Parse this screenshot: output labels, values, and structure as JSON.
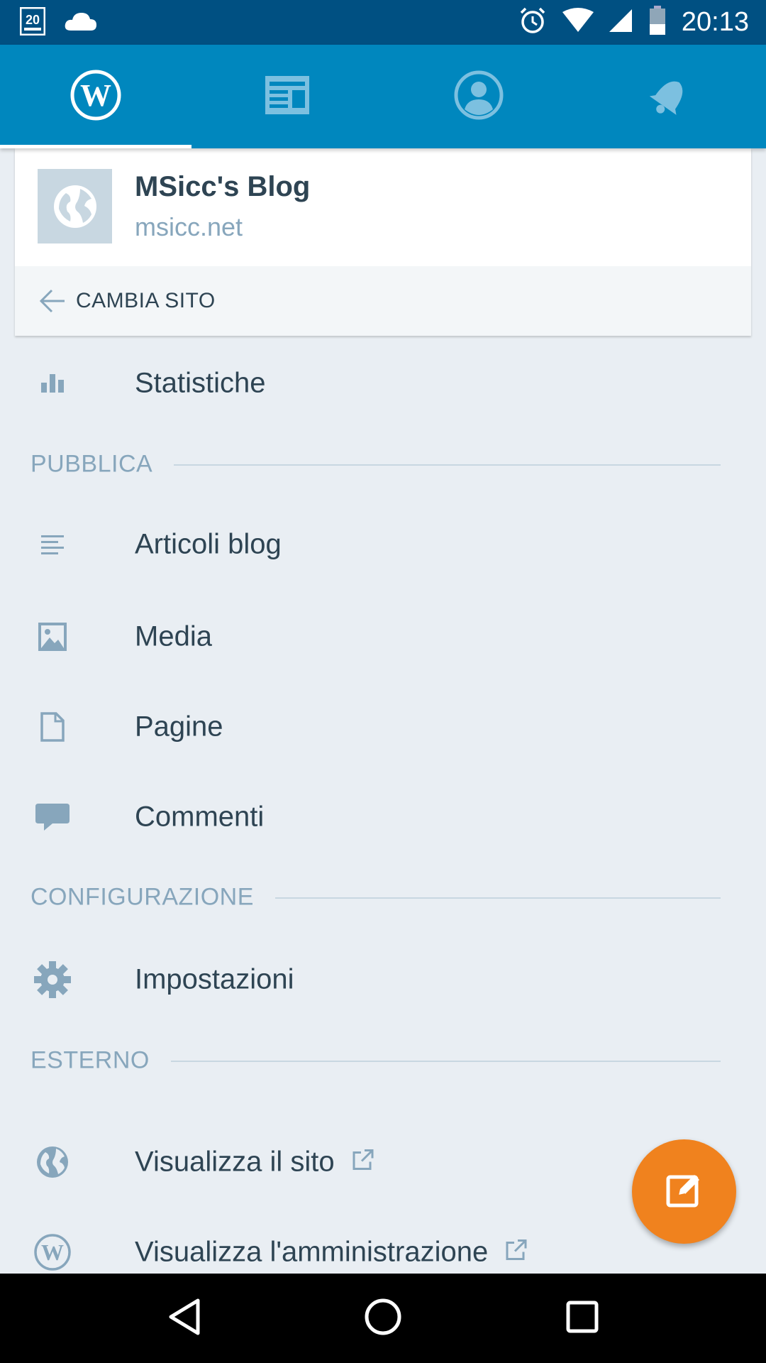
{
  "status_bar": {
    "time": "20:13",
    "left_icons": [
      "news-20minuten-icon",
      "cloud-icon"
    ],
    "right_icons": [
      "alarm-icon",
      "wifi-icon",
      "signal-icon",
      "battery-icon"
    ]
  },
  "tabs": [
    {
      "name": "my-site",
      "icon": "wordpress-icon",
      "active": true
    },
    {
      "name": "reader",
      "icon": "reader-icon",
      "active": false
    },
    {
      "name": "me",
      "icon": "profile-icon",
      "active": false
    },
    {
      "name": "notifications",
      "icon": "bell-icon",
      "active": false
    }
  ],
  "site": {
    "name": "MSicc's Blog",
    "url": "msicc.net",
    "switch_label": "CAMBIA SITO"
  },
  "menu": {
    "stats": "Statistiche",
    "sections": {
      "publish": "PUBBLICA",
      "config": "CONFIGURAZIONE",
      "external": "ESTERNO"
    },
    "posts": "Articoli blog",
    "media": "Media",
    "pages": "Pagine",
    "comments": "Commenti",
    "settings": "Impostazioni",
    "view_site": "Visualizza il sito",
    "view_admin": "Visualizza l'amministrazione"
  },
  "colors": {
    "statusbar": "#005082",
    "tabbar": "#0087be",
    "background": "#e9eef3",
    "text": "#2e4453",
    "muted": "#87a6bc",
    "fab": "#f0821e"
  }
}
